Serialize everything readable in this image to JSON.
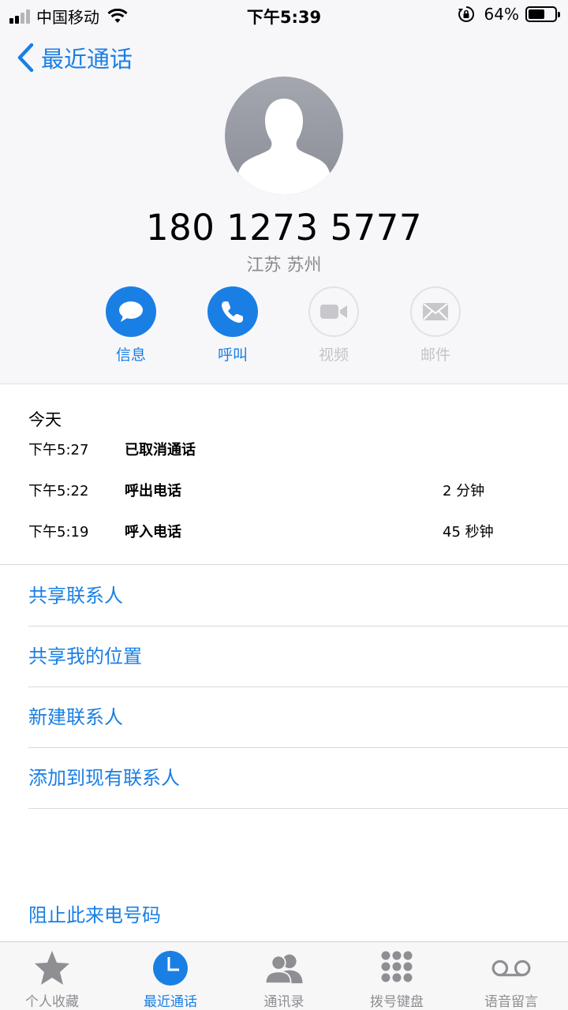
{
  "status_bar": {
    "carrier": "中国移动",
    "time": "下午5:39",
    "battery_percent": "64%",
    "battery_level": 0.64
  },
  "nav": {
    "back_label": "最近通话"
  },
  "contact": {
    "avatar_icon": "person-silhouette-icon",
    "number": "180 1273 5777",
    "location": "江苏 苏州"
  },
  "actions": [
    {
      "label": "信息",
      "icon": "message-bubble-icon",
      "enabled": true
    },
    {
      "label": "呼叫",
      "icon": "phone-icon",
      "enabled": true
    },
    {
      "label": "视频",
      "icon": "video-camera-icon",
      "enabled": false
    },
    {
      "label": "邮件",
      "icon": "envelope-icon",
      "enabled": false
    }
  ],
  "history": {
    "title": "今天",
    "calls": [
      {
        "time": "下午5:27",
        "type": "已取消通话",
        "duration": ""
      },
      {
        "time": "下午5:22",
        "type": "呼出电话",
        "duration": "2 分钟"
      },
      {
        "time": "下午5:19",
        "type": "呼入电话",
        "duration": "45 秒钟"
      }
    ]
  },
  "options": [
    "共享联系人",
    "共享我的位置",
    "新建联系人",
    "添加到现有联系人"
  ],
  "block_label": "阻止此来电号码",
  "tabs": [
    {
      "label": "个人收藏",
      "icon": "star-icon",
      "selected": false
    },
    {
      "label": "最近通话",
      "icon": "clock-icon",
      "selected": true
    },
    {
      "label": "通讯录",
      "icon": "contacts-icon",
      "selected": false
    },
    {
      "label": "拨号键盘",
      "icon": "keypad-icon",
      "selected": false
    },
    {
      "label": "语音留言",
      "icon": "voicemail-icon",
      "selected": false
    }
  ],
  "colors": {
    "accent": "#1a7fe4",
    "inactive_gray": "#c4c4c8",
    "tab_gray": "#8e8e93"
  }
}
